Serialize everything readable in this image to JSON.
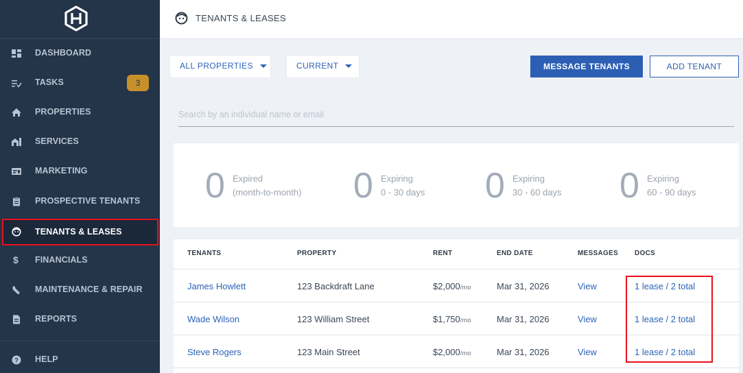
{
  "sidebar": {
    "items": [
      {
        "label": "DASHBOARD",
        "icon": "dashboard-icon"
      },
      {
        "label": "TASKS",
        "icon": "tasks-icon",
        "badge": "3"
      },
      {
        "label": "PROPERTIES",
        "icon": "home-icon"
      },
      {
        "label": "SERVICES",
        "icon": "services-icon"
      },
      {
        "label": "MARKETING",
        "icon": "marketing-icon"
      },
      {
        "label": "PROSPECTIVE TENANTS",
        "icon": "clipboard-icon"
      },
      {
        "label": "TENANTS & LEASES",
        "icon": "face-icon",
        "active": true
      },
      {
        "label": "FINANCIALS",
        "icon": "dollar-icon"
      },
      {
        "label": "MAINTENANCE & REPAIR",
        "icon": "wrench-icon"
      },
      {
        "label": "REPORTS",
        "icon": "document-icon"
      },
      {
        "label": "HELP",
        "icon": "help-icon"
      }
    ]
  },
  "header": {
    "title": "TENANTS & LEASES"
  },
  "filters": {
    "properties": "ALL PROPERTIES",
    "status": "CURRENT"
  },
  "actions": {
    "message": "MESSAGE TENANTS",
    "add": "ADD TENANT"
  },
  "search": {
    "placeholder": "Search by an individual name or email"
  },
  "stats": [
    {
      "value": "0",
      "line1": "Expired",
      "line2": "(month-to-month)"
    },
    {
      "value": "0",
      "line1": "Expiring",
      "line2": "0 - 30 days"
    },
    {
      "value": "0",
      "line1": "Expiring",
      "line2": "30 - 60 days"
    },
    {
      "value": "0",
      "line1": "Expiring",
      "line2": "60 - 90 days"
    }
  ],
  "table": {
    "headers": [
      "TENANTS",
      "PROPERTY",
      "RENT",
      "END DATE",
      "MESSAGES",
      "DOCS"
    ],
    "per": "/mo",
    "rows": [
      {
        "tenant": "James Howlett",
        "property": "123 Backdraft Lane",
        "rent": "$2,000",
        "end": "Mar 31, 2026",
        "messages": "View",
        "docs": "1 lease / 2 total"
      },
      {
        "tenant": "Wade Wilson",
        "property": "123 William Street",
        "rent": "$1,750",
        "end": "Mar 31, 2026",
        "messages": "View",
        "docs": "1 lease / 2 total"
      },
      {
        "tenant": "Steve Rogers",
        "property": "123 Main Street",
        "rent": "$2,000",
        "end": "Mar 31, 2026",
        "messages": "View",
        "docs": "1 lease / 2 total"
      }
    ]
  },
  "colors": {
    "sidebar": "#243449",
    "accent": "#2c5fb4",
    "badge": "#c8902b",
    "highlight": "#e8101b"
  }
}
